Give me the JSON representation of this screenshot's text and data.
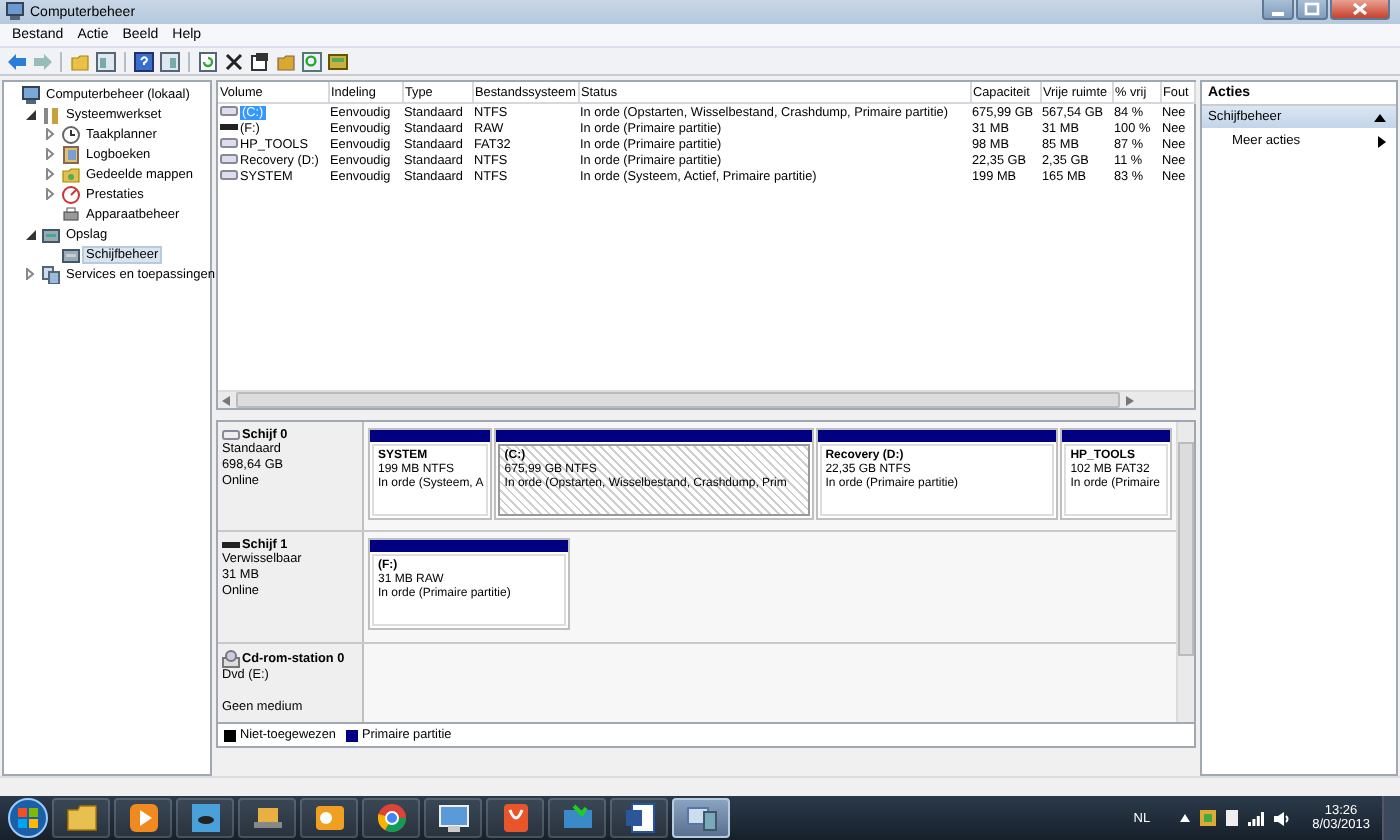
{
  "window": {
    "title": "Computerbeheer"
  },
  "menu": [
    "Bestand",
    "Actie",
    "Beeld",
    "Help"
  ],
  "tree": [
    {
      "label": "Computerbeheer (lokaal)",
      "selected": false,
      "children": [
        {
          "label": "Systeemwerkset",
          "expanded": true,
          "selected": false,
          "children": [
            {
              "label": "Taakplanner",
              "expanded": false,
              "selected": false
            },
            {
              "label": "Logboeken",
              "expanded": false,
              "selected": false
            },
            {
              "label": "Gedeelde mappen",
              "expanded": false,
              "selected": false
            },
            {
              "label": "Prestaties",
              "expanded": false,
              "selected": false
            },
            {
              "label": "Apparaatbeheer",
              "selected": false
            }
          ]
        },
        {
          "label": "Opslag",
          "expanded": true,
          "selected": false,
          "children": [
            {
              "label": "Schijfbeheer",
              "selected": true
            }
          ]
        },
        {
          "label": "Services en toepassingen",
          "expanded": false,
          "selected": false
        }
      ]
    }
  ],
  "table": {
    "columns": [
      "Volume",
      "Indeling",
      "Type",
      "Bestandssysteem",
      "Status",
      "Capaciteit",
      "Vrije ruimte",
      "% vrij",
      "Fout"
    ],
    "rows": [
      {
        "selected": true,
        "kind": "fixed",
        "cells": [
          "(C:)",
          "Eenvoudig",
          "Standaard",
          "NTFS",
          "In orde (Opstarten, Wisselbestand, Crashdump, Primaire partitie)",
          "675,99 GB",
          "567,54 GB",
          "84 %",
          "Nee"
        ]
      },
      {
        "selected": false,
        "kind": "removable",
        "cells": [
          "(F:)",
          "Eenvoudig",
          "Standaard",
          "RAW",
          "In orde (Primaire partitie)",
          "31 MB",
          "31 MB",
          "100 %",
          "Nee"
        ]
      },
      {
        "selected": false,
        "kind": "fixed",
        "cells": [
          "HP_TOOLS",
          "Eenvoudig",
          "Standaard",
          "FAT32",
          "In orde (Primaire partitie)",
          "98 MB",
          "85 MB",
          "87 %",
          "Nee"
        ]
      },
      {
        "selected": false,
        "kind": "fixed",
        "cells": [
          "Recovery (D:)",
          "Eenvoudig",
          "Standaard",
          "NTFS",
          "In orde (Primaire partitie)",
          "22,35 GB",
          "2,35 GB",
          "11 %",
          "Nee"
        ]
      },
      {
        "selected": false,
        "kind": "fixed",
        "cells": [
          "SYSTEM",
          "Eenvoudig",
          "Standaard",
          "NTFS",
          "In orde (Systeem, Actief, Primaire partitie)",
          "199 MB",
          "165 MB",
          "83 %",
          "Nee"
        ]
      }
    ]
  },
  "disks": [
    {
      "kind": "fixed",
      "name": "Schijf 0",
      "type": "Standaard",
      "size": "698,64 GB",
      "status": "Online",
      "partitions": [
        {
          "name": "SYSTEM",
          "detail": "199 MB NTFS",
          "status": "In orde (Systeem, A",
          "selected": false,
          "color": "#000080"
        },
        {
          "name": "(C:)",
          "detail": "675,99 GB NTFS",
          "status": "In orde (Opstarten, Wisselbestand, Crashdump, Prim",
          "selected": true,
          "color": "#000080"
        },
        {
          "name": "Recovery  (D:)",
          "detail": "22,35 GB NTFS",
          "status": "In orde (Primaire partitie)",
          "selected": false,
          "color": "#000080"
        },
        {
          "name": "HP_TOOLS",
          "detail": "102 MB FAT32",
          "status": "In orde (Primaire",
          "selected": false,
          "color": "#000080"
        }
      ]
    },
    {
      "kind": "removable",
      "name": "Schijf 1",
      "type": "Verwisselbaar",
      "size": "31 MB",
      "status": "Online",
      "partitions": [
        {
          "name": "(F:)",
          "detail": "31 MB RAW",
          "status": "In orde (Primaire partitie)",
          "selected": false,
          "color": "#000080"
        }
      ]
    },
    {
      "kind": "optical",
      "name": "Cd-rom-station 0",
      "type": "Dvd (E:)",
      "status": "Geen medium"
    }
  ],
  "legend": [
    {
      "label": "Niet-toegewezen",
      "color": "#000000"
    },
    {
      "label": "Primaire partitie",
      "color": "#000080"
    }
  ],
  "actions": {
    "title": "Acties",
    "section": "Schijfbeheer",
    "items": [
      "Meer acties"
    ]
  },
  "taskbar": {
    "apps": [
      {
        "selected": false
      },
      {
        "selected": false
      },
      {
        "selected": false
      },
      {
        "selected": false
      },
      {
        "selected": false
      },
      {
        "selected": false
      },
      {
        "selected": false
      },
      {
        "selected": false
      },
      {
        "selected": false
      },
      {
        "selected": false
      },
      {
        "selected": true
      }
    ],
    "language": "NL",
    "time": "13:26",
    "date": "8/03/2013"
  }
}
